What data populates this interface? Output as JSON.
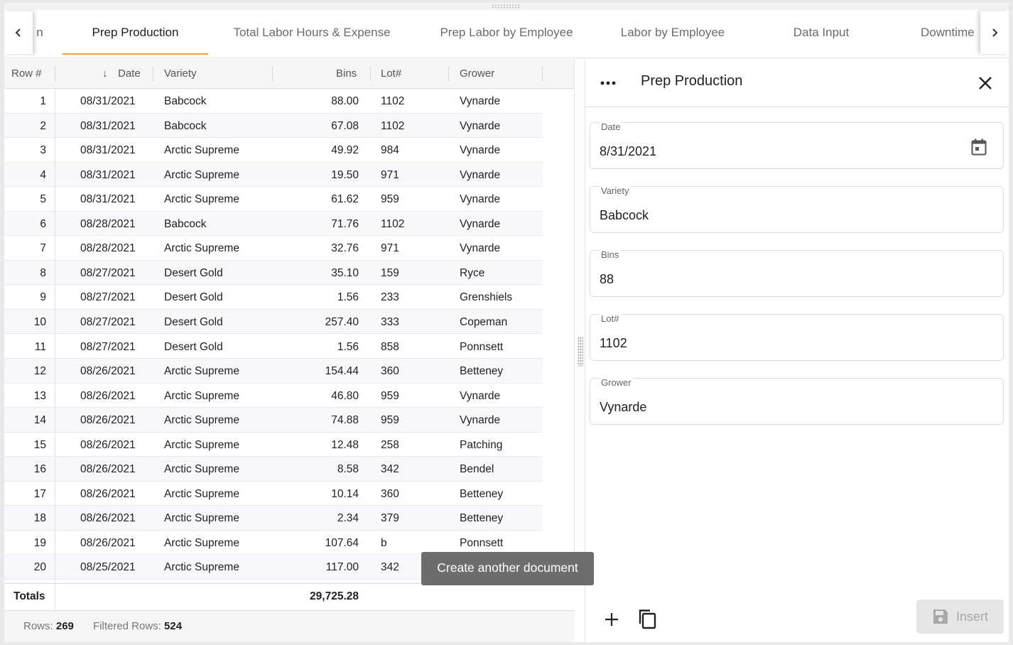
{
  "tabs": [
    {
      "label": "n",
      "active": false
    },
    {
      "label": "Prep Production",
      "active": true
    },
    {
      "label": "Total Labor Hours & Expense",
      "active": false
    },
    {
      "label": "Prep Labor by Employee",
      "active": false
    },
    {
      "label": "Labor by Employee",
      "active": false
    },
    {
      "label": "Data Input",
      "active": false
    },
    {
      "label": "Downtime",
      "active": false
    }
  ],
  "grid": {
    "columns": {
      "row": "Row #",
      "date": "Date",
      "variety": "Variety",
      "bins": "Bins",
      "lot": "Lot#",
      "grower": "Grower"
    },
    "sort_indicator": "↓",
    "rows": [
      {
        "row": "1",
        "date": "08/31/2021",
        "variety": "Babcock",
        "bins": "88.00",
        "lot": "1102",
        "grower": "Vynarde"
      },
      {
        "row": "2",
        "date": "08/31/2021",
        "variety": "Babcock",
        "bins": "67.08",
        "lot": "1102",
        "grower": "Vynarde"
      },
      {
        "row": "3",
        "date": "08/31/2021",
        "variety": "Arctic Supreme",
        "bins": "49.92",
        "lot": "984",
        "grower": "Vynarde"
      },
      {
        "row": "4",
        "date": "08/31/2021",
        "variety": "Arctic Supreme",
        "bins": "19.50",
        "lot": "971",
        "grower": "Vynarde"
      },
      {
        "row": "5",
        "date": "08/31/2021",
        "variety": "Arctic Supreme",
        "bins": "61.62",
        "lot": "959",
        "grower": "Vynarde"
      },
      {
        "row": "6",
        "date": "08/28/2021",
        "variety": "Babcock",
        "bins": "71.76",
        "lot": "1102",
        "grower": "Vynarde"
      },
      {
        "row": "7",
        "date": "08/28/2021",
        "variety": "Arctic Supreme",
        "bins": "32.76",
        "lot": "971",
        "grower": "Vynarde"
      },
      {
        "row": "8",
        "date": "08/27/2021",
        "variety": "Desert Gold",
        "bins": "35.10",
        "lot": "159",
        "grower": "Ryce"
      },
      {
        "row": "9",
        "date": "08/27/2021",
        "variety": "Desert Gold",
        "bins": "1.56",
        "lot": "233",
        "grower": "Grenshiels"
      },
      {
        "row": "10",
        "date": "08/27/2021",
        "variety": "Desert Gold",
        "bins": "257.40",
        "lot": "333",
        "grower": "Copeman"
      },
      {
        "row": "11",
        "date": "08/27/2021",
        "variety": "Desert Gold",
        "bins": "1.56",
        "lot": "858",
        "grower": "Ponnsett"
      },
      {
        "row": "12",
        "date": "08/26/2021",
        "variety": "Arctic Supreme",
        "bins": "154.44",
        "lot": "360",
        "grower": "Betteney"
      },
      {
        "row": "13",
        "date": "08/26/2021",
        "variety": "Arctic Supreme",
        "bins": "46.80",
        "lot": "959",
        "grower": "Vynarde"
      },
      {
        "row": "14",
        "date": "08/26/2021",
        "variety": "Arctic Supreme",
        "bins": "74.88",
        "lot": "959",
        "grower": "Vynarde"
      },
      {
        "row": "15",
        "date": "08/26/2021",
        "variety": "Arctic Supreme",
        "bins": "12.48",
        "lot": "258",
        "grower": "Patching"
      },
      {
        "row": "16",
        "date": "08/26/2021",
        "variety": "Arctic Supreme",
        "bins": "8.58",
        "lot": "342",
        "grower": "Bendel"
      },
      {
        "row": "17",
        "date": "08/26/2021",
        "variety": "Arctic Supreme",
        "bins": "10.14",
        "lot": "360",
        "grower": "Betteney"
      },
      {
        "row": "18",
        "date": "08/26/2021",
        "variety": "Arctic Supreme",
        "bins": "2.34",
        "lot": "379",
        "grower": "Betteney"
      },
      {
        "row": "19",
        "date": "08/26/2021",
        "variety": "Arctic Supreme",
        "bins": "107.64",
        "lot": "b",
        "grower": "Ponnsett"
      },
      {
        "row": "20",
        "date": "08/25/2021",
        "variety": "Arctic Supreme",
        "bins": "117.00",
        "lot": "342",
        "grower": ""
      }
    ],
    "totals_label": "Totals",
    "totals_bins": "29,725.28",
    "footer": {
      "rows_label": "Rows:",
      "rows_value": "269",
      "filtered_label": "Filtered Rows:",
      "filtered_value": "524"
    }
  },
  "form": {
    "title": "Prep Production",
    "fields": [
      {
        "label": "Date",
        "value": "8/31/2021"
      },
      {
        "label": "Variety",
        "value": "Babcock"
      },
      {
        "label": "Bins",
        "value": "88"
      },
      {
        "label": "Lot#",
        "value": "1102"
      },
      {
        "label": "Grower",
        "value": "Vynarde"
      }
    ],
    "tooltip": "Create another document",
    "insert_label": "Insert"
  },
  "colors": {
    "accent": "#f0a13a",
    "alt_row": "#f6f8fc",
    "tooltip_bg": "#6d6d6d"
  }
}
